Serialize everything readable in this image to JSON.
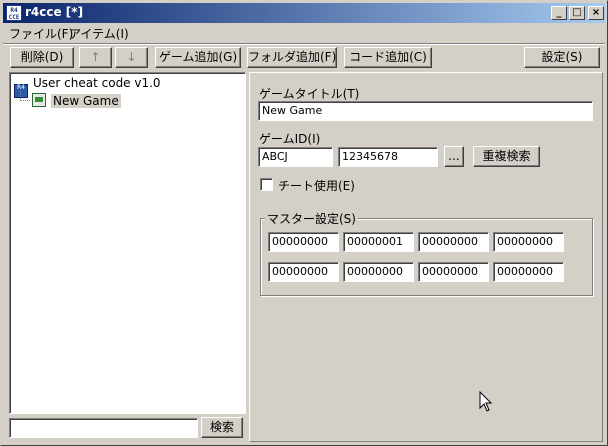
{
  "window": {
    "title": "r4cce [*]",
    "app_icon_text": "R4 CCE"
  },
  "menu": {
    "file": "ファイル(F)",
    "item": "アイテム(I)"
  },
  "toolbar": {
    "delete": "削除(D)",
    "up": "↑",
    "down": "↓",
    "add_game": "ゲーム追加(G)",
    "add_folder": "フォルダ追加(F)",
    "add_code": "コード追加(C)",
    "settings": "設定(S)"
  },
  "tree": {
    "root": "User cheat code v1.0",
    "child": "New Game"
  },
  "search": {
    "button": "検索",
    "value": ""
  },
  "form": {
    "game_title_label": "ゲームタイトル(T)",
    "game_title_value": "New Game",
    "game_id_label": "ゲームID(I)",
    "game_id_value": "ABCJ",
    "game_id_number": "12345678",
    "browse_button": "...",
    "duplicate_search_button": "重複検索",
    "cheat_use_label": "チート使用(E)",
    "cheat_use_checked": false,
    "master_label": "マスター設定(S)",
    "master_codes": [
      [
        "00000000",
        "00000001",
        "00000000",
        "00000000"
      ],
      [
        "00000000",
        "00000000",
        "00000000",
        "00000000"
      ]
    ]
  }
}
